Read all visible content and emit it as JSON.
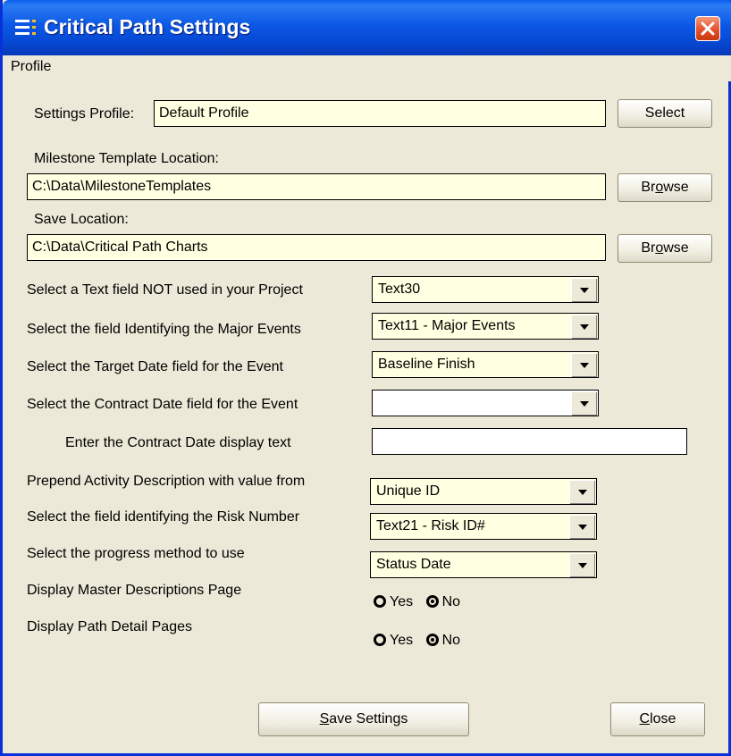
{
  "window": {
    "title": "Critical Path Settings"
  },
  "menu": {
    "profile": "Profile"
  },
  "settings_profile": {
    "label": "Settings Profile:",
    "value": "Default Profile",
    "button": "Select"
  },
  "milestone": {
    "label": "Milestone Template Location:",
    "value": "C:\\Data\\MilestoneTemplates",
    "button_pre": "Br",
    "button_key": "o",
    "button_post": "wse"
  },
  "save_location": {
    "label": "Save Location:",
    "value": "C:\\Data\\Critical Path Charts",
    "button_pre": "Br",
    "button_key": "o",
    "button_post": "wse"
  },
  "fields": {
    "text_field": {
      "label": "Select a Text field NOT used in your Project",
      "value": "Text30"
    },
    "major_events": {
      "label": "Select the field Identifying the Major Events",
      "value": "Text11 - Major Events"
    },
    "target_date": {
      "label": "Select the Target Date field for the Event",
      "value": "Baseline Finish"
    },
    "contract_date": {
      "label": "Select the Contract Date field for the Event",
      "value": ""
    },
    "contract_text": {
      "label": "Enter the Contract Date display text",
      "value": ""
    },
    "prepend": {
      "label": "Prepend Activity Description with value from",
      "value": "Unique ID"
    },
    "risk": {
      "label": "Select the field identifying the Risk Number",
      "value": "Text21 - Risk ID#"
    },
    "progress": {
      "label": "Select the progress method to use",
      "value": "Status Date"
    }
  },
  "master_desc": {
    "label": "Display Master Descriptions Page",
    "yes": "Yes",
    "no": "No",
    "selected": "No"
  },
  "path_detail": {
    "label": "Display Path Detail Pages",
    "yes": "Yes",
    "no": "No",
    "selected": "No"
  },
  "footer": {
    "save_key": "S",
    "save_rest": "ave Settings",
    "close_key": "C",
    "close_rest": "lose"
  }
}
